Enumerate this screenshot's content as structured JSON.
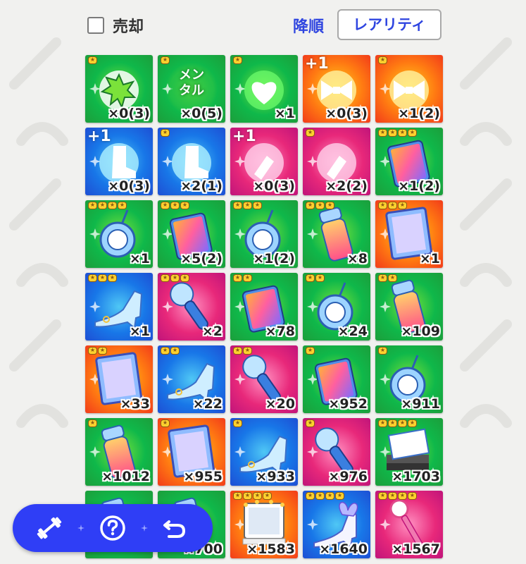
{
  "header": {
    "sell_label": "売却",
    "sort_order_label": "降順",
    "sort_key_label": "レアリティ"
  },
  "colors": {
    "accent": "#2f45e0",
    "fab": "#2f3ef6"
  },
  "items": [
    {
      "bg": "green",
      "stars": 1,
      "icon": "burst-icon",
      "count": "×0(3)"
    },
    {
      "bg": "green",
      "stars": 1,
      "icon": "mental-text-icon",
      "label": "メン タル",
      "count": "×0(5)"
    },
    {
      "bg": "green",
      "stars": 1,
      "icon": "heart-icon",
      "count": "×1"
    },
    {
      "bg": "orange",
      "plus": "+1",
      "icon": "ribbon-icon",
      "count": "×0(3)"
    },
    {
      "bg": "orange",
      "stars": 1,
      "icon": "ribbon-icon",
      "count": "×1(2)"
    },
    {
      "bg": "blue",
      "plus": "+1",
      "icon": "boot-icon",
      "count": "×0(3)"
    },
    {
      "bg": "blue",
      "stars": 1,
      "icon": "boot-icon",
      "count": "×2(1)"
    },
    {
      "bg": "pink",
      "plus": "+1",
      "icon": "flashlight-icon",
      "count": "×0(3)"
    },
    {
      "bg": "pink",
      "stars": 1,
      "icon": "flashlight-icon",
      "count": "×2(2)"
    },
    {
      "bg": "green",
      "stars": 4,
      "icon": "tablet-icon",
      "count": "×1(2)"
    },
    {
      "bg": "green",
      "stars": 4,
      "icon": "compact-mirror-icon",
      "count": "×1"
    },
    {
      "bg": "green",
      "stars": 3,
      "icon": "tablet-icon",
      "count": "×5(2)"
    },
    {
      "bg": "green",
      "stars": 3,
      "icon": "compact-mirror-icon",
      "count": "×1(2)"
    },
    {
      "bg": "green",
      "stars": 3,
      "icon": "bottle-icon",
      "count": "×8"
    },
    {
      "bg": "orange",
      "stars": 3,
      "icon": "mirror-icon",
      "count": "×1"
    },
    {
      "bg": "blue",
      "stars": 3,
      "icon": "glass-slipper-icon",
      "count": "×1"
    },
    {
      "bg": "pink",
      "stars": 3,
      "icon": "microphone-icon",
      "count": "×2"
    },
    {
      "bg": "green",
      "stars": 2,
      "icon": "tablet-icon",
      "count": "×78"
    },
    {
      "bg": "green",
      "stars": 2,
      "icon": "compact-mirror-icon",
      "count": "×24"
    },
    {
      "bg": "green",
      "stars": 2,
      "icon": "bottle-icon",
      "count": "×109"
    },
    {
      "bg": "orange",
      "stars": 2,
      "icon": "mirror-icon",
      "count": "×33"
    },
    {
      "bg": "blue",
      "stars": 2,
      "icon": "glass-slipper-icon",
      "count": "×22"
    },
    {
      "bg": "pink",
      "stars": 2,
      "icon": "microphone-icon",
      "count": "×20"
    },
    {
      "bg": "green",
      "stars": 1,
      "icon": "tablet-icon",
      "count": "×952"
    },
    {
      "bg": "green",
      "stars": 1,
      "icon": "compact-mirror-icon",
      "count": "×911"
    },
    {
      "bg": "green",
      "stars": 1,
      "icon": "bottle-icon",
      "count": "×1012"
    },
    {
      "bg": "orange",
      "stars": 1,
      "icon": "mirror-icon",
      "count": "×955"
    },
    {
      "bg": "blue",
      "stars": 1,
      "icon": "glass-slipper-icon",
      "count": "×933"
    },
    {
      "bg": "pink",
      "stars": 1,
      "icon": "microphone-icon",
      "count": "×976"
    },
    {
      "bg": "green",
      "stars": 4,
      "icon": "books-icon",
      "count": "×1703"
    },
    {
      "bg": "green",
      "stars": 0,
      "icon": "bottle-icon",
      "count": ""
    },
    {
      "bg": "green",
      "stars": 0,
      "icon": "bottle-icon",
      "count": "×700"
    },
    {
      "bg": "orange",
      "stars": 4,
      "icon": "vanity-mirror-icon",
      "count": "×1583"
    },
    {
      "bg": "blue",
      "stars": 4,
      "icon": "fairy-shoe-icon",
      "count": "×1640"
    },
    {
      "bg": "pink",
      "stars": 4,
      "icon": "magic-wand-icon",
      "count": "×1567"
    }
  ],
  "fab": {
    "buttons": [
      {
        "icon": "dumbbell-icon"
      },
      {
        "icon": "help-icon"
      },
      {
        "icon": "back-icon"
      }
    ]
  }
}
